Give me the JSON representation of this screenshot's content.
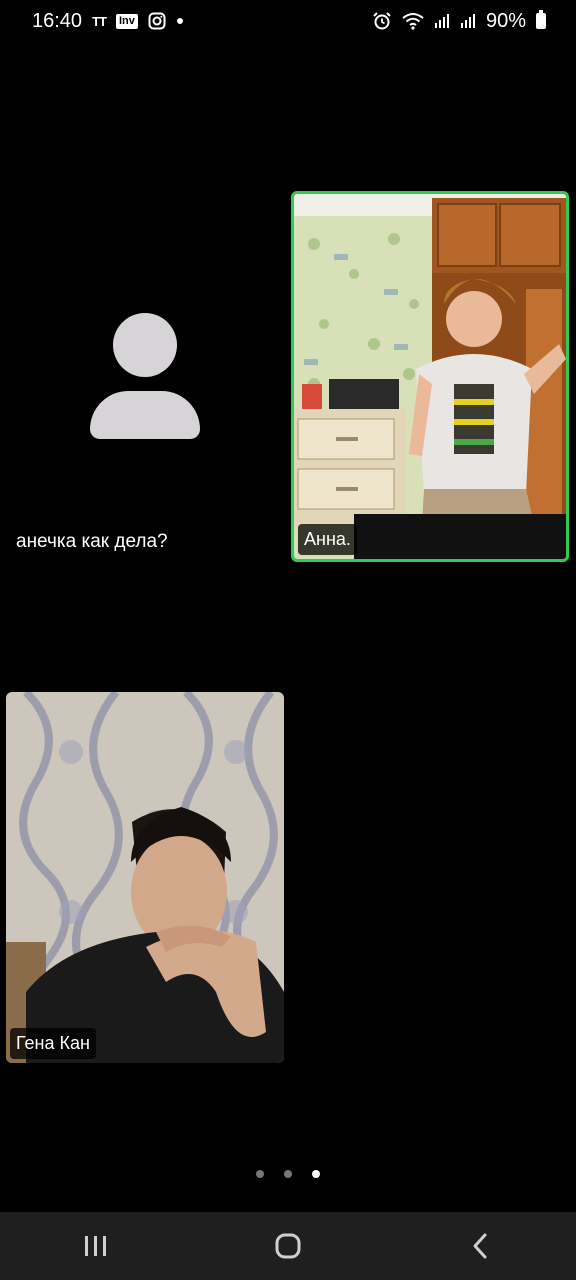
{
  "status_bar": {
    "time": "16:40",
    "battery": "90%",
    "notif_icons": [
      "tt-icon",
      "inv-icon",
      "instagram-icon",
      "dot-icon"
    ],
    "sys_icons": [
      "alarm-icon",
      "wifi-icon",
      "signal-icon",
      "signal-icon",
      "battery-icon"
    ],
    "tt_label": "TT",
    "inv_label": "Inv"
  },
  "participants": [
    {
      "name": "Анна.",
      "active_speaker": true,
      "accent_color": "#2ecc55"
    },
    {
      "name": "Гена Кан",
      "active_speaker": false
    }
  ],
  "avatar_tile": {
    "caption": "анечка как дела?"
  },
  "pagination": {
    "total": 3,
    "current": 3
  },
  "nav_bar": {
    "buttons": [
      "recents-button",
      "home-button",
      "back-button"
    ]
  }
}
